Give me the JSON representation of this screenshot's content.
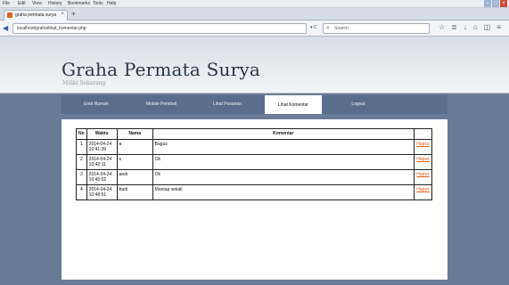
{
  "browser": {
    "menu_items": [
      "File",
      "Edit",
      "View",
      "History",
      "Bookmarks",
      "Tools",
      "Help"
    ],
    "tab_title": "graha permata surya",
    "tab_close": "×",
    "new_tab": "+",
    "url": "localhost/graha/lihat_komentar.php",
    "search_placeholder": "Search",
    "back_icon": "back-arrow-icon"
  },
  "site": {
    "title": "Graha Permata Surya",
    "subtitle": "Miliki Sekarang"
  },
  "nav": {
    "items": [
      {
        "label": "Entri Rumah"
      },
      {
        "label": "Mobile Pembeli"
      },
      {
        "label": "Lihat Pesanan"
      },
      {
        "label": "Lihat Komentar"
      },
      {
        "label": "Logout"
      }
    ],
    "active_index": 3
  },
  "table": {
    "headers": {
      "no": "No",
      "waktu": "Waktu",
      "nama": "Nama",
      "komentar": "Komentar",
      "aksi": ""
    },
    "rows": [
      {
        "no": "1",
        "waktu": "2014-04-24 10:41:39",
        "nama": "a",
        "komentar": "Bagus",
        "aksi": "Hapus"
      },
      {
        "no": "2",
        "waktu": "2014-04-24 10:42:11",
        "nama": "s",
        "komentar": "Ok",
        "aksi": "Hapus"
      },
      {
        "no": "3",
        "waktu": "2014-04-24 10:45:02",
        "nama": "andi",
        "komentar": "Ok",
        "aksi": "Hapus"
      },
      {
        "no": "4",
        "waktu": "2014-04-24 10:48:51",
        "nama": "budi",
        "komentar": "Mantap sekali",
        "aksi": "Hapus"
      }
    ]
  },
  "colors": {
    "background": "#6a7b96",
    "nav_bar": "#5a6d8c",
    "link": "#e05a1a"
  }
}
